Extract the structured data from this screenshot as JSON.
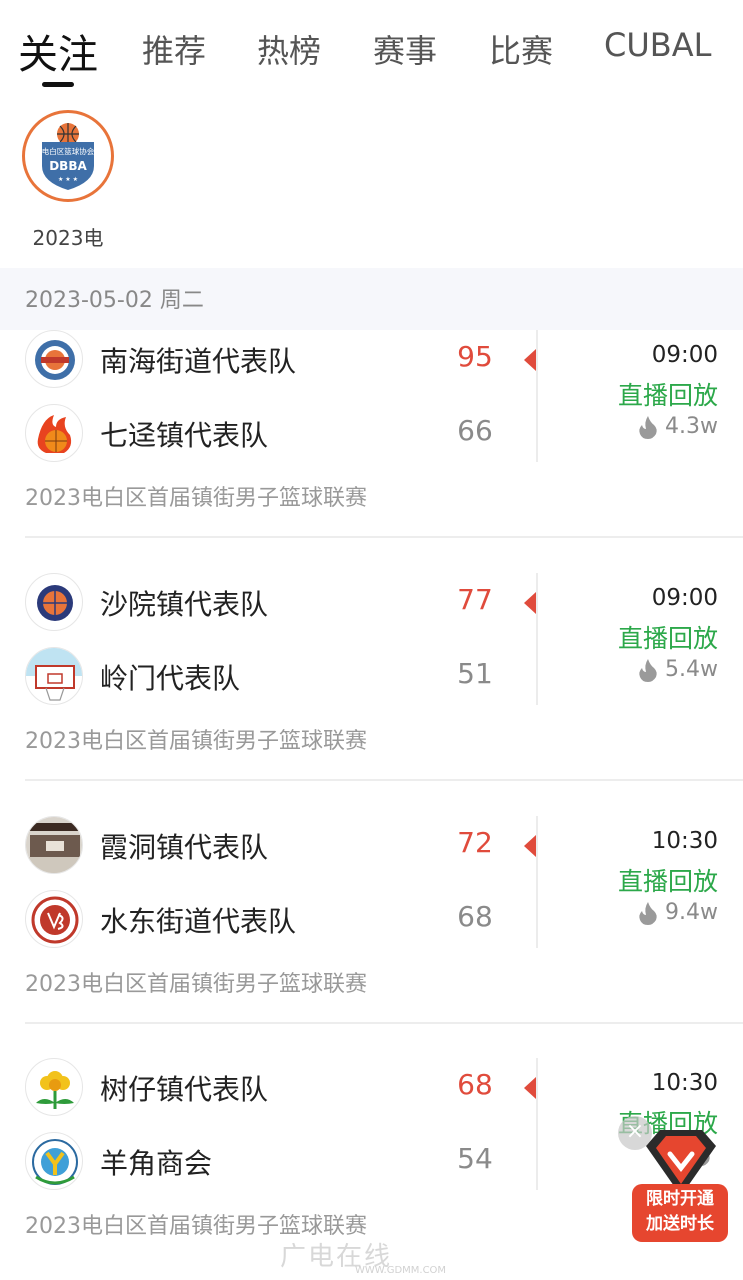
{
  "tabs": [
    {
      "label": "关注",
      "active": true
    },
    {
      "label": "推荐"
    },
    {
      "label": "热榜"
    },
    {
      "label": "赛事"
    },
    {
      "label": "比赛"
    },
    {
      "label": "CUBAL"
    }
  ],
  "league": {
    "name": "2023电",
    "logo_text_top": "电白区篮球协会",
    "logo_text_main": "DBBA",
    "brand_color": "#e8743a"
  },
  "date_label": "2023-05-02 周二",
  "colors": {
    "win": "#e04b3c",
    "lose": "#8a8a8a",
    "replay": "#2ca84a"
  },
  "matches": [
    {
      "home": {
        "name": "南海街道代表队",
        "score": "95",
        "icon": "team-logo"
      },
      "away": {
        "name": "七迳镇代表队",
        "score": "66",
        "icon": "fire-basketball-logo"
      },
      "time": "09:00",
      "status": "直播回放",
      "heat": "4.3w",
      "league": "2023电白区首届镇街男子篮球联赛"
    },
    {
      "home": {
        "name": "沙院镇代表队",
        "score": "77",
        "icon": "team-logo"
      },
      "away": {
        "name": "岭门代表队",
        "score": "51",
        "icon": "hoop-logo"
      },
      "time": "09:00",
      "status": "直播回放",
      "heat": "5.4w",
      "league": "2023电白区首届镇街男子篮球联赛"
    },
    {
      "home": {
        "name": "霞洞镇代表队",
        "score": "72",
        "icon": "building-logo"
      },
      "away": {
        "name": "水东街道代表队",
        "score": "68",
        "icon": "team-logo"
      },
      "time": "10:30",
      "status": "直播回放",
      "heat": "9.4w",
      "league": "2023电白区首届镇街男子篮球联赛"
    },
    {
      "home": {
        "name": "树仔镇代表队",
        "score": "68",
        "icon": "flower-logo"
      },
      "away": {
        "name": "羊角商会",
        "score": "54",
        "icon": "team-logo"
      },
      "time": "10:30",
      "status": "直播回放",
      "heat": "",
      "league": "2023电白区首届镇街男子篮球联赛"
    }
  ],
  "promo": {
    "line1": "限时开通",
    "line2": "加送时长"
  },
  "watermark": {
    "main": "广电在线",
    "sub": "WWW.GDMM.COM"
  }
}
